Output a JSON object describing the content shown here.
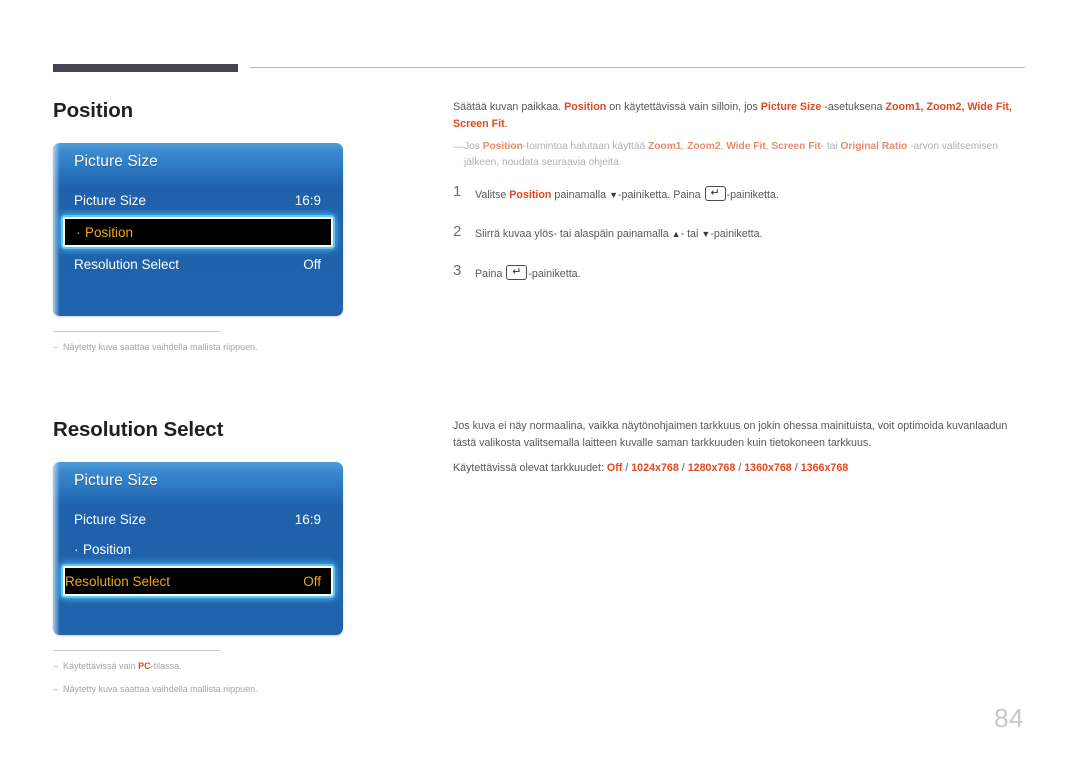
{
  "page": {
    "number": "84"
  },
  "sections": [
    {
      "heading": "Position",
      "osd": {
        "title": "Picture Size",
        "rows": [
          {
            "label": "Picture Size",
            "value": "16:9",
            "bullet": "",
            "selected": false
          },
          {
            "label": "Position",
            "value": "",
            "bullet": "·",
            "selected": true
          },
          {
            "label": "Resolution Select",
            "value": "Off",
            "bullet": "",
            "selected": false
          }
        ]
      },
      "footnotes": [
        {
          "dash": "–",
          "text": "Näytetty kuva saattaa vaihdella mallista riippuen."
        }
      ],
      "body": {
        "intro_1": "Säätää kuvan paikkaa. ",
        "intro_b1": "Position",
        "intro_2": " on käytettävissä vain silloin, jos ",
        "intro_b2": "Picture Size",
        "intro_3": " -asetuksena ",
        "intro_b3": "Zoom1, Zoom2, Wide Fit, Screen Fit",
        "intro_4": ".",
        "note_dash": "—",
        "note_1": "Jos ",
        "note_b1": "Position",
        "note_2": "-toimintoa halutaan käyttää ",
        "note_b2": "Zoom1",
        "note_3": ", ",
        "note_b3": "Zoom2",
        "note_4": ", ",
        "note_b4": "Wide Fit",
        "note_5": ", ",
        "note_b5": "Screen Fit",
        "note_6": "- tai ",
        "note_b6": "Original Ratio",
        "note_7": " -arvon valitsemisen jälkeen, noudata seuraavia ohjeita.",
        "steps": [
          {
            "num": "1",
            "t1": "Valitse ",
            "b1": "Position",
            "t2": " painamalla ",
            "tri1": "▼",
            "t3": "-painiketta. Paina ",
            "key": true,
            "t4": "-painiketta."
          },
          {
            "num": "2",
            "t1": "Siirrä kuvaa ylös- tai alaspäin painamalla ",
            "b1": "",
            "t2": "",
            "tri1": "▲",
            "t3": "- tai ",
            "tri2": "▼",
            "t4": "-painiketta."
          },
          {
            "num": "3",
            "t1": "Paina ",
            "key": true,
            "t4": "-painiketta."
          }
        ]
      }
    },
    {
      "heading": "Resolution Select",
      "osd": {
        "title": "Picture Size",
        "rows": [
          {
            "label": "Picture Size",
            "value": "16:9",
            "bullet": "",
            "selected": false
          },
          {
            "label": "Position",
            "value": "",
            "bullet": "·",
            "selected": false
          },
          {
            "label": "Resolution Select",
            "value": "Off",
            "bullet": "",
            "selected": true
          }
        ]
      },
      "footnotes": [
        {
          "dash": "–",
          "pre": "Käytettävissä vain ",
          "bold": "PC",
          "post": "-tilassa."
        },
        {
          "dash": "–",
          "text": "Näytetty kuva saattaa vaihdella mallista riippuen."
        }
      ],
      "body": {
        "para": "Jos kuva ei näy normaalina, vaikka näytönohjaimen tarkkuus on jokin ohessa mainituista, voit optimoida kuvanlaadun tästä valikosta valitsemalla laitteen kuvalle saman tarkkuuden kuin tietokoneen tarkkuus.",
        "res_label": "Käytettävissä olevat tarkkuudet: ",
        "res_values": [
          "Off",
          "1024x768",
          "1280x768",
          "1360x768",
          "1366x768"
        ],
        "res_sep": " / "
      }
    }
  ]
}
